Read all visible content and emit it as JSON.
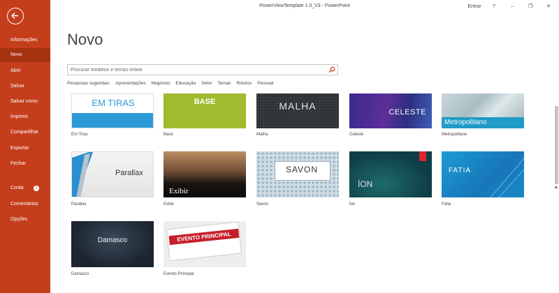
{
  "window": {
    "title": "PowerViewTemplate 1.0_V3  -  PowerPoint",
    "signin": "Entrar",
    "help": "?",
    "minimize": "–",
    "restore": "❐",
    "close": "✕"
  },
  "sidebar": {
    "items": [
      {
        "label": "Informações"
      },
      {
        "label": "Novo"
      },
      {
        "label": "Abrir"
      },
      {
        "label": "Salvar"
      },
      {
        "label": "Salvar como"
      },
      {
        "label": "Imprimir"
      },
      {
        "label": "Compartilhar"
      },
      {
        "label": "Exportar"
      },
      {
        "label": "Fechar"
      },
      {
        "label": "Conta"
      },
      {
        "label": "Comentários"
      },
      {
        "label": "Opções"
      }
    ],
    "active": "Novo",
    "info_glyph": "i"
  },
  "main": {
    "title": "Novo",
    "search_placeholder": "Procurar modelos e temas online",
    "suggested_label": "Pesquisas sugeridas:",
    "suggested": [
      "Apresentações",
      "Negócios",
      "Educação",
      "Setor",
      "Temas",
      "Rótulos",
      "Pessoal"
    ]
  },
  "templates": [
    {
      "name": "Em Tiras",
      "thumb_text": "EM TIRAS"
    },
    {
      "name": "Base",
      "thumb_text": "BASE"
    },
    {
      "name": "Malha",
      "thumb_text": "MALHA"
    },
    {
      "name": "Celeste",
      "thumb_text": "CELESTE"
    },
    {
      "name": "Metropolitano",
      "thumb_text": "Metropolitano"
    },
    {
      "name": "Parallax",
      "thumb_text": "Parallax"
    },
    {
      "name": "Exibir",
      "thumb_text": "Exibir"
    },
    {
      "name": "Savon",
      "thumb_text": "SAVON"
    },
    {
      "name": "Íon",
      "thumb_text": "ÍON"
    },
    {
      "name": "Fatia",
      "thumb_text": "FATIA"
    },
    {
      "name": "Damasco",
      "thumb_text": "Damasco"
    },
    {
      "name": "Evento Principal",
      "thumb_text": "EVENTO PRINCIPAL"
    }
  ],
  "colors": {
    "accent": "#c43e1c",
    "accent_active": "#a6310f"
  }
}
